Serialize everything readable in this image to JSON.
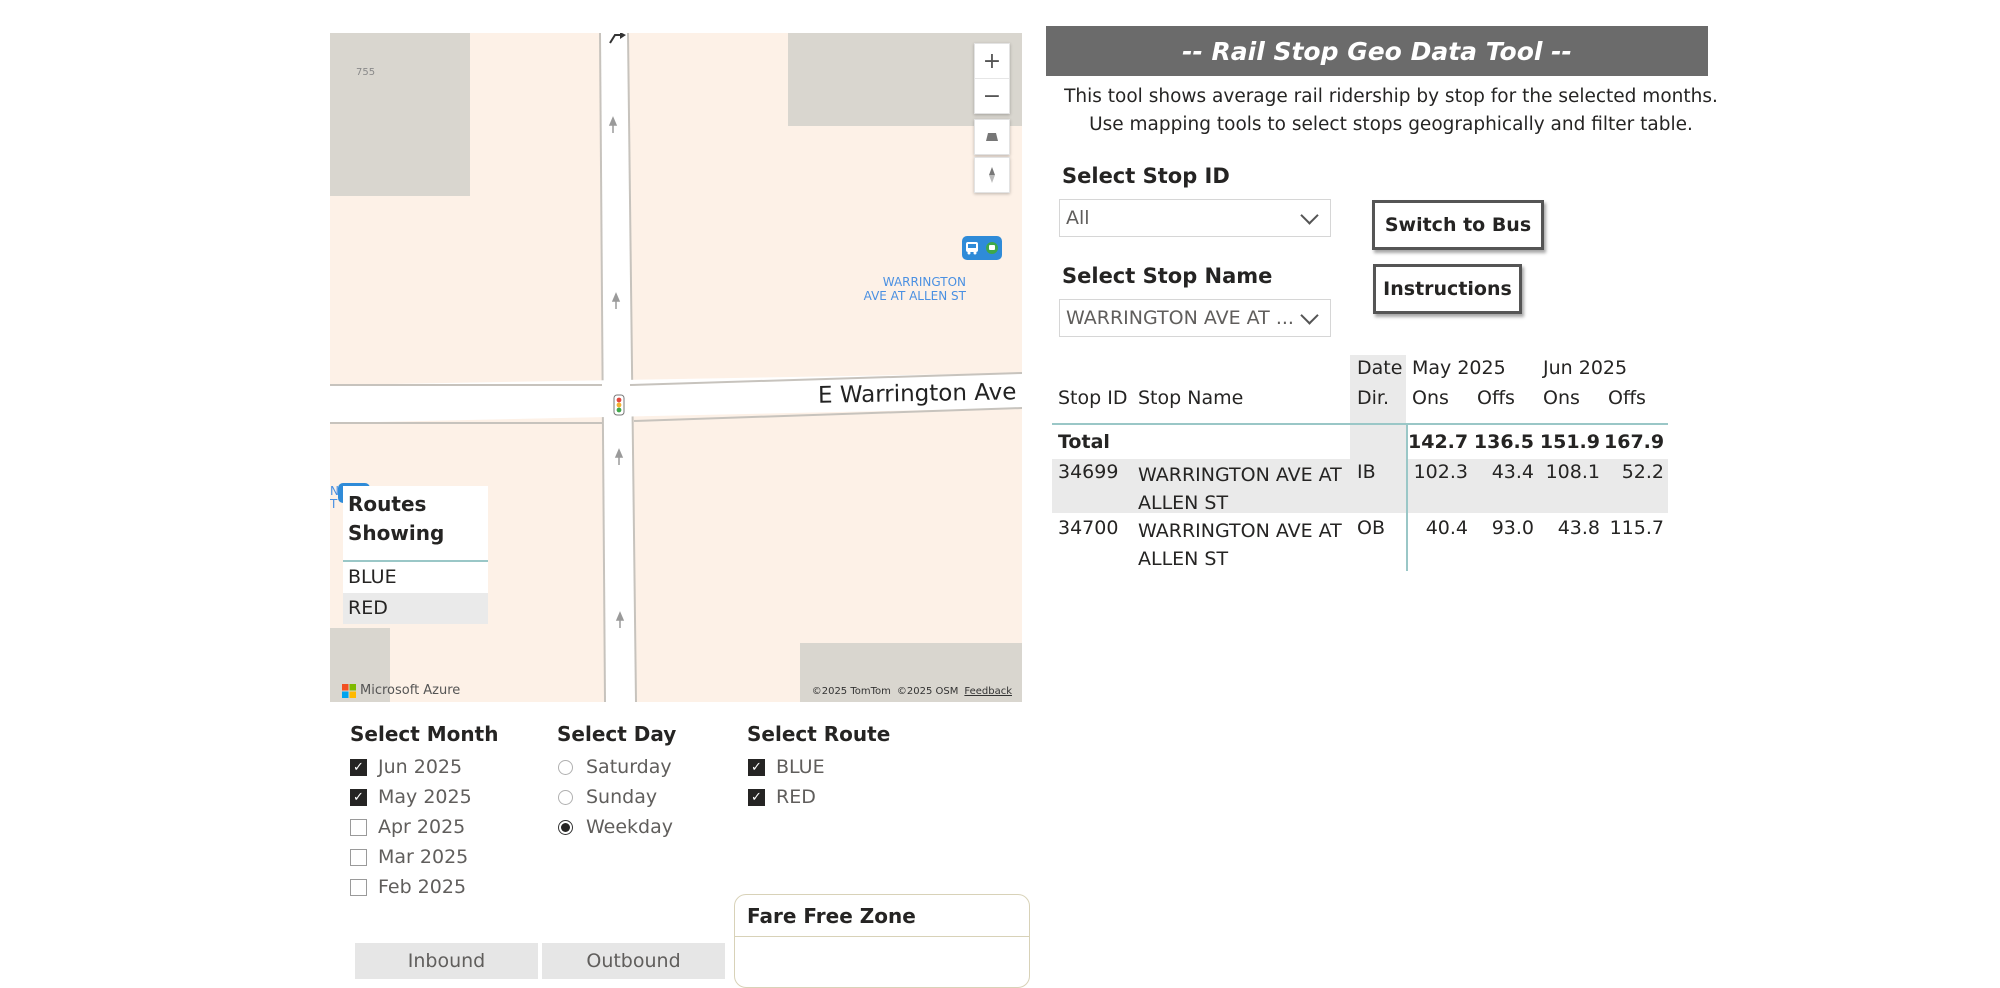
{
  "map": {
    "street_label": "E Warrington Ave",
    "building_number": "755",
    "stop_label_line1": "WARRINGTON",
    "stop_label_line2": "AVE AT ALLEN ST",
    "partial_label_1": "N",
    "partial_label_2": "T",
    "brand": "Microsoft Azure",
    "attribution_1": "©2025 TomTom",
    "attribution_2": "©2025 OSM",
    "attribution_link": "Feedback",
    "controls": {
      "zoom_in": "+",
      "zoom_out": "−"
    },
    "routes_legend": {
      "title": "Routes Showing",
      "items": [
        "BLUE",
        "RED"
      ]
    }
  },
  "filters": {
    "month": {
      "title": "Select Month",
      "options": [
        {
          "label": "Jun 2025",
          "checked": true
        },
        {
          "label": "May 2025",
          "checked": true
        },
        {
          "label": "Apr 2025",
          "checked": false
        },
        {
          "label": "Mar 2025",
          "checked": false
        },
        {
          "label": "Feb 2025",
          "checked": false
        }
      ]
    },
    "day": {
      "title": "Select Day",
      "options": [
        {
          "label": "Saturday",
          "selected": false
        },
        {
          "label": "Sunday",
          "selected": false
        },
        {
          "label": "Weekday",
          "selected": true
        }
      ]
    },
    "route": {
      "title": "Select Route",
      "options": [
        {
          "label": "BLUE",
          "checked": true
        },
        {
          "label": "RED",
          "checked": true
        }
      ]
    },
    "direction_buttons": {
      "inbound": "Inbound",
      "outbound": "Outbound"
    },
    "fare_free_zone": {
      "title": "Fare Free Zone"
    }
  },
  "panel": {
    "title": "-- Rail Stop Geo Data Tool --",
    "description_line1": "This tool shows average rail ridership by stop for the selected months.",
    "description_line2": "Use mapping tools to select stops geographically and filter table.",
    "stop_id_slicer": {
      "title": "Select Stop ID",
      "value": "All"
    },
    "stop_name_slicer": {
      "title": "Select Stop Name",
      "value": "WARRINGTON AVE AT ..."
    },
    "switch_button": "Switch to Bus",
    "instructions_button": "Instructions"
  },
  "table": {
    "header_top": {
      "date": "Date",
      "month1": "May 2025",
      "month2": "Jun 2025"
    },
    "header": {
      "stop_id": "Stop ID",
      "stop_name": "Stop Name",
      "dir": "Dir.",
      "ons1": "Ons",
      "offs1": "Offs",
      "ons2": "Ons",
      "offs2": "Offs"
    },
    "total": {
      "label": "Total",
      "may_ons": "142.7",
      "may_offs": "136.5",
      "jun_ons": "151.9",
      "jun_offs": "167.9"
    },
    "rows": [
      {
        "stop_id": "34699",
        "name_line1": "WARRINGTON AVE AT",
        "name_line2": "ALLEN ST",
        "dir": "IB",
        "may_ons": "102.3",
        "may_offs": "43.4",
        "jun_ons": "108.1",
        "jun_offs": "52.2"
      },
      {
        "stop_id": "34700",
        "name_line1": "WARRINGTON AVE AT",
        "name_line2": "ALLEN ST",
        "dir": "OB",
        "may_ons": "40.4",
        "may_offs": "93.0",
        "jun_ons": "43.8",
        "jun_offs": "115.7"
      }
    ]
  },
  "colors": {
    "title_bar": "#6b6b6b",
    "map_land": "#fdf1e7",
    "map_building": "#d9d6cf",
    "table_rule": "#9ac7c7"
  }
}
